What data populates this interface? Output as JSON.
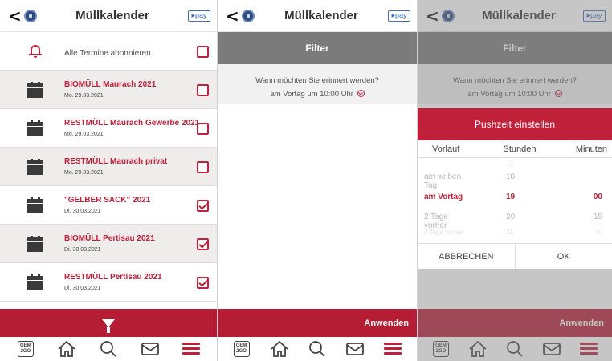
{
  "header": {
    "back": "<",
    "title": "Müllkalender",
    "pay": "▸pay"
  },
  "list": {
    "subscribe_label": "Alle Termine abonnieren",
    "items": [
      {
        "name": "BIOMÜLL Maurach 2021",
        "date": "Mo. 29.03.2021",
        "checked": false
      },
      {
        "name": "RESTMÜLL Maurach Gewerbe 2021",
        "date": "Mo. 29.03.2021",
        "checked": false
      },
      {
        "name": "RESTMÜLL Maurach privat",
        "date": "Mo. 29.03.2021",
        "checked": false
      },
      {
        "name": "\"GELBER SACK\" 2021",
        "date": "Di. 30.03.2021",
        "checked": true
      },
      {
        "name": "BIOMÜLL Pertisau 2021",
        "date": "Di. 30.03.2021",
        "checked": true
      },
      {
        "name": "RESTMÜLL Pertisau 2021",
        "date": "Di. 30.03.2021",
        "checked": true
      }
    ]
  },
  "filter": {
    "title": "Filter",
    "question": "Wann möchten Sie erinnert werden?",
    "selection": "am Vortag um 10:00 Uhr",
    "apply_label": "Anwenden"
  },
  "dialog": {
    "title": "Pushzeit einstellen",
    "col_vorlauf": "Vorlauf",
    "col_stunden": "Stunden",
    "col_minuten": "Minuten",
    "rows": [
      {
        "vorlauf": "",
        "stunden": "17",
        "minuten": ""
      },
      {
        "vorlauf": "am selben Tag",
        "stunden": "18",
        "minuten": ""
      },
      {
        "vorlauf": "am Vortag",
        "stunden": "19",
        "minuten": "00"
      },
      {
        "vorlauf": "2 Tage vorher",
        "stunden": "20",
        "minuten": "15"
      },
      {
        "vorlauf": "3 Tage vorher",
        "stunden": "21",
        "minuten": "30"
      }
    ],
    "cancel_label": "ABBRECHEN",
    "ok_label": "OK"
  },
  "nav": {
    "gem_text": "GEM 2GO",
    "icons": [
      "gem2go-icon",
      "home-icon",
      "search-icon",
      "mail-icon",
      "menu-icon"
    ]
  },
  "colors": {
    "accent": "#b51d35",
    "header_gray": "#7b7b7b"
  }
}
